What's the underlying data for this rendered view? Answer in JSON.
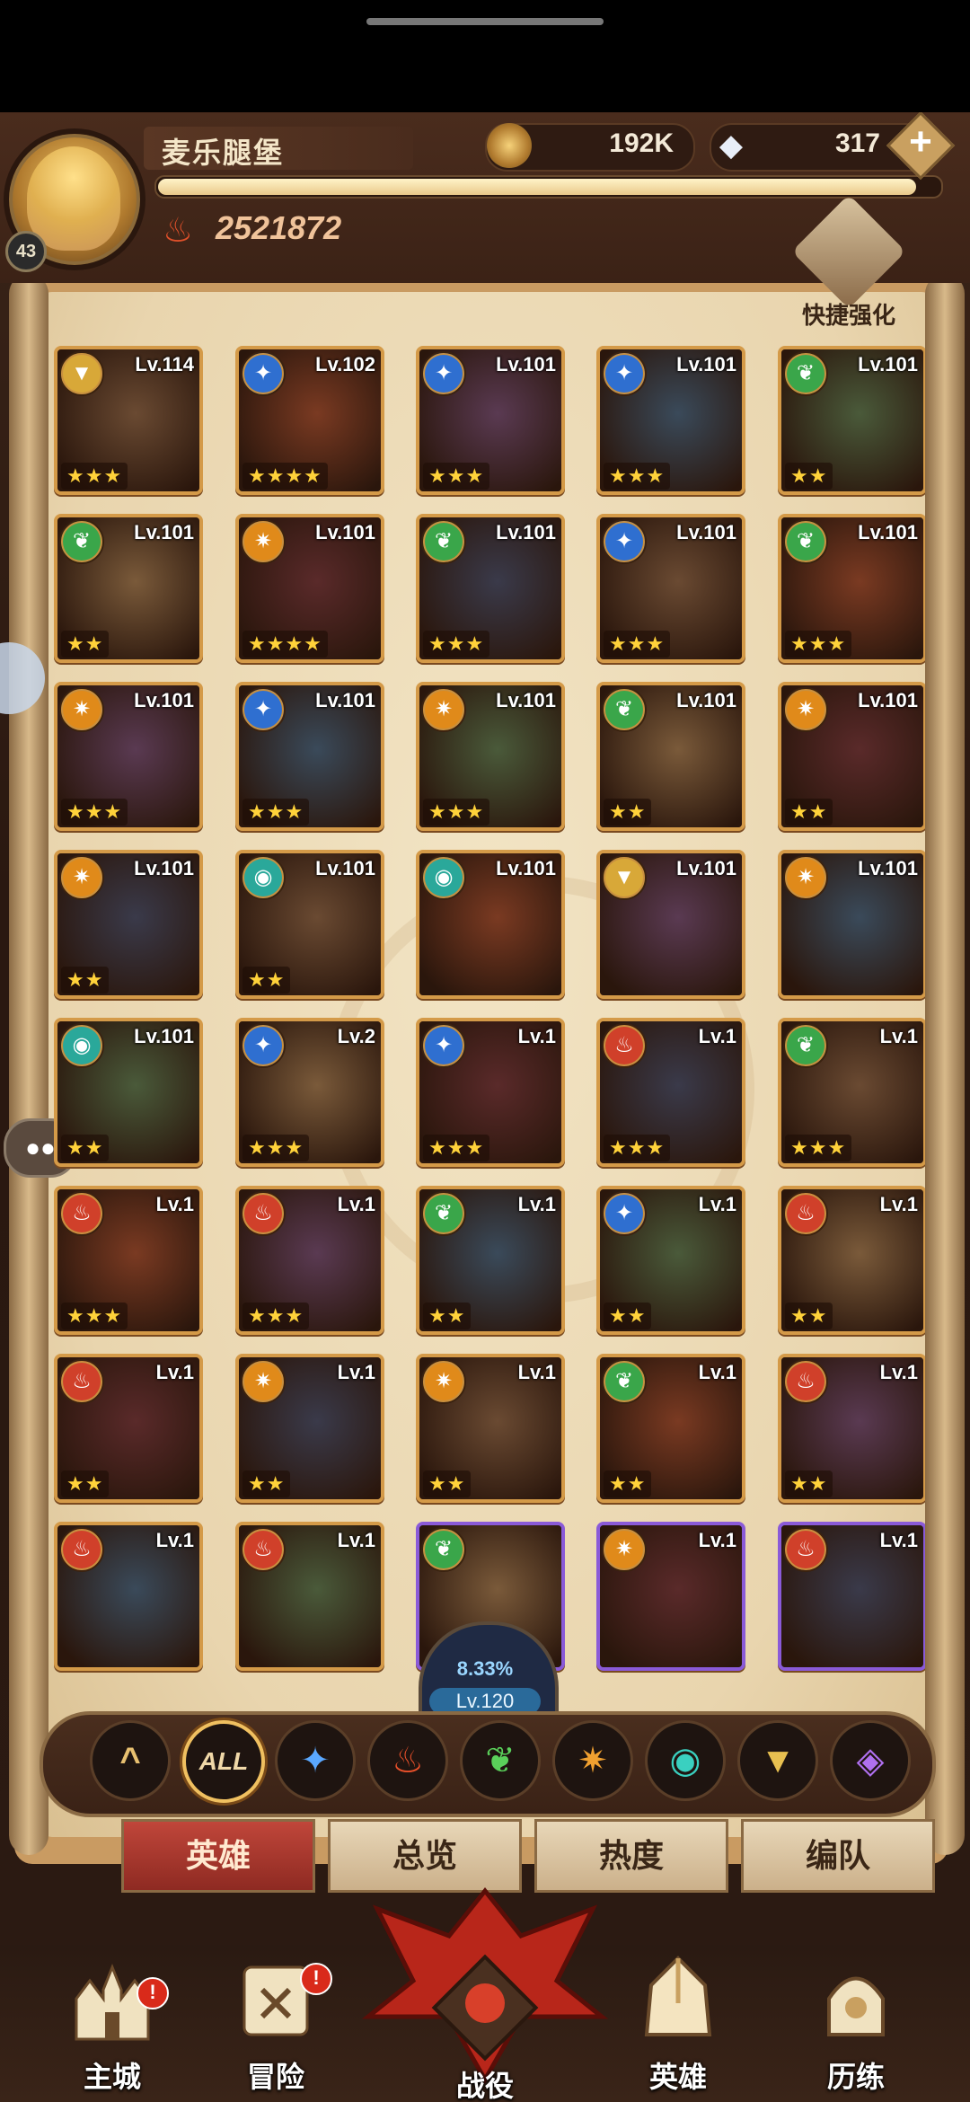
{
  "player": {
    "name": "麦乐腿堡",
    "level": "43",
    "power": "2521872",
    "xp_progress": 0.97
  },
  "currency": {
    "coins": "192K",
    "gems": "317"
  },
  "quick_upgrade_label": "快捷强化",
  "heroes": [
    {
      "level": "Lv.114",
      "stars": 3,
      "faction": "celestial",
      "rare": false
    },
    {
      "level": "Lv.102",
      "stars": 4,
      "faction": "lightbearer",
      "rare": false
    },
    {
      "level": "Lv.101",
      "stars": 3,
      "faction": "lightbearer",
      "rare": false
    },
    {
      "level": "Lv.101",
      "stars": 3,
      "faction": "lightbearer",
      "rare": false
    },
    {
      "level": "Lv.101",
      "stars": 2,
      "faction": "wilder",
      "rare": false
    },
    {
      "level": "Lv.101",
      "stars": 2,
      "faction": "wilder",
      "rare": false
    },
    {
      "level": "Lv.101",
      "stars": 4,
      "faction": "mauler",
      "rare": false
    },
    {
      "level": "Lv.101",
      "stars": 3,
      "faction": "wilder",
      "rare": false
    },
    {
      "level": "Lv.101",
      "stars": 3,
      "faction": "lightbearer",
      "rare": false
    },
    {
      "level": "Lv.101",
      "stars": 3,
      "faction": "wilder",
      "rare": false
    },
    {
      "level": "Lv.101",
      "stars": 3,
      "faction": "mauler",
      "rare": false
    },
    {
      "level": "Lv.101",
      "stars": 3,
      "faction": "lightbearer",
      "rare": false
    },
    {
      "level": "Lv.101",
      "stars": 3,
      "faction": "mauler",
      "rare": false
    },
    {
      "level": "Lv.101",
      "stars": 2,
      "faction": "wilder",
      "rare": false
    },
    {
      "level": "Lv.101",
      "stars": 2,
      "faction": "mauler",
      "rare": false
    },
    {
      "level": "Lv.101",
      "stars": 2,
      "faction": "mauler",
      "rare": false
    },
    {
      "level": "Lv.101",
      "stars": 2,
      "faction": "hypogean",
      "rare": false
    },
    {
      "level": "Lv.101",
      "stars": 0,
      "faction": "hypogean",
      "rare": false
    },
    {
      "level": "Lv.101",
      "stars": 0,
      "faction": "celestial",
      "rare": false
    },
    {
      "level": "Lv.101",
      "stars": 0,
      "faction": "mauler",
      "rare": false
    },
    {
      "level": "Lv.101",
      "stars": 2,
      "faction": "hypogean",
      "rare": false
    },
    {
      "level": "Lv.2",
      "stars": 3,
      "faction": "lightbearer",
      "rare": false
    },
    {
      "level": "Lv.1",
      "stars": 3,
      "faction": "lightbearer",
      "rare": false
    },
    {
      "level": "Lv.1",
      "stars": 3,
      "faction": "graveborn",
      "rare": false
    },
    {
      "level": "Lv.1",
      "stars": 3,
      "faction": "wilder",
      "rare": false
    },
    {
      "level": "Lv.1",
      "stars": 3,
      "faction": "graveborn",
      "rare": false
    },
    {
      "level": "Lv.1",
      "stars": 3,
      "faction": "graveborn",
      "rare": false
    },
    {
      "level": "Lv.1",
      "stars": 2,
      "faction": "wilder",
      "rare": false
    },
    {
      "level": "Lv.1",
      "stars": 2,
      "faction": "lightbearer",
      "rare": false
    },
    {
      "level": "Lv.1",
      "stars": 2,
      "faction": "graveborn",
      "rare": false
    },
    {
      "level": "Lv.1",
      "stars": 2,
      "faction": "graveborn",
      "rare": false
    },
    {
      "level": "Lv.1",
      "stars": 2,
      "faction": "mauler",
      "rare": false
    },
    {
      "level": "Lv.1",
      "stars": 2,
      "faction": "mauler",
      "rare": false
    },
    {
      "level": "Lv.1",
      "stars": 2,
      "faction": "wilder",
      "rare": false
    },
    {
      "level": "Lv.1",
      "stars": 2,
      "faction": "graveborn",
      "rare": false
    },
    {
      "level": "Lv.1",
      "stars": 0,
      "faction": "graveborn",
      "rare": false
    },
    {
      "level": "Lv.1",
      "stars": 0,
      "faction": "graveborn",
      "rare": false
    },
    {
      "level": "",
      "stars": 0,
      "faction": "wilder",
      "rare": true
    },
    {
      "level": "Lv.1",
      "stars": 0,
      "faction": "mauler",
      "rare": true
    },
    {
      "level": "Lv.1",
      "stars": 0,
      "faction": "graveborn",
      "rare": true
    }
  ],
  "faction_colors": {
    "lightbearer": "#2f6fd0",
    "mauler": "#e08a1a",
    "wilder": "#3aa64a",
    "graveborn": "#d0402a",
    "celestial": "#d8a838",
    "hypogean": "#2aa89a",
    "dimensional": "#8a4ad8"
  },
  "filters": [
    {
      "name": "collapse",
      "label": "^",
      "color": "#e8c070"
    },
    {
      "name": "all",
      "label": "ALL",
      "color": "#f0d8a8",
      "active": true
    },
    {
      "name": "lightbearer",
      "label": "✦",
      "color": "#5aa8ff"
    },
    {
      "name": "mauler",
      "label": "♨",
      "color": "#e8502a"
    },
    {
      "name": "wilder",
      "label": "❦",
      "color": "#5ad05a"
    },
    {
      "name": "graveborn",
      "label": "✷",
      "color": "#f0a030"
    },
    {
      "name": "hypogean",
      "label": "◉",
      "color": "#3ad0c0"
    },
    {
      "name": "celestial",
      "label": "▼",
      "color": "#e8c050"
    },
    {
      "name": "dimensional",
      "label": "◈",
      "color": "#b070f0"
    }
  ],
  "progress": {
    "percent": "8.33%",
    "level": "Lv.120"
  },
  "tabs": [
    "英雄",
    "总览",
    "热度",
    "编队"
  ],
  "nav": [
    {
      "label": "主城",
      "alert": true
    },
    {
      "label": "冒险",
      "alert": true
    },
    {
      "label": "战役",
      "alert": false
    },
    {
      "label": "英雄",
      "alert": false
    },
    {
      "label": "历练",
      "alert": false
    }
  ]
}
